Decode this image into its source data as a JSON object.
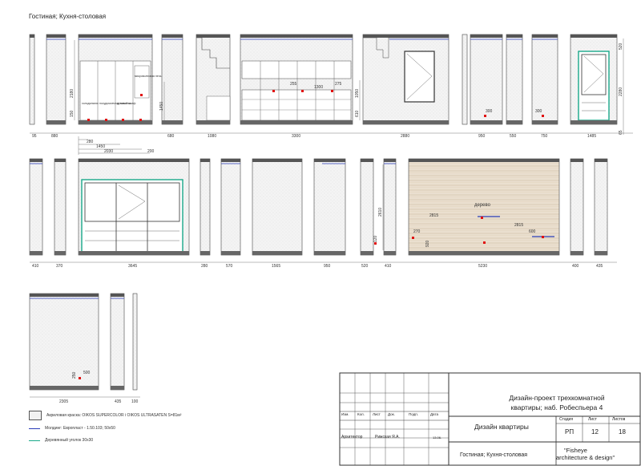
{
  "page_title": "Гостиная; Кухня-столовая",
  "row1_dims": [
    "95",
    "880",
    "680",
    "1080",
    "3300",
    "2880",
    "950",
    "550",
    "750",
    "1485"
  ],
  "row1_vdims": [
    "2180",
    "150",
    "1450",
    "1050",
    "610",
    "270",
    "100",
    "2280",
    "520",
    "65"
  ],
  "row1_kitchen_dims": [
    "1300",
    "1450",
    "2030",
    "280",
    "200",
    "255",
    "275"
  ],
  "row1_small_dims": [
    "300",
    "300",
    "150",
    "250"
  ],
  "row2_dims": [
    "410",
    "370",
    "3645",
    "280",
    "570",
    "1565",
    "950",
    "520",
    "410",
    "5230",
    "400",
    "435"
  ],
  "row2_vdims": [
    "2610",
    "120",
    "100",
    "160",
    "250",
    "920"
  ],
  "wood_label": "дерево",
  "wood_dims": [
    "2815",
    "2815",
    "270",
    "600",
    "920"
  ],
  "row3_dims": [
    "2305",
    "435",
    "100"
  ],
  "row3_small_dims": [
    "250",
    "500"
  ],
  "appliance_labels": [
    "холодильник",
    "посудомоечная машина",
    "духовой шкаф",
    "микроволновая печь"
  ],
  "legend": {
    "paint": "Акриловая краска: OIKOS SUPERCOLOR i OIKOS ULTRASATEN  S=81м²",
    "molding": "Молдинг: Европласт - 1.50.103; 50х50",
    "corner": "Деревянный уголок 30х30"
  },
  "colors": {
    "blue": "#2b3db8",
    "teal": "#1aa98a",
    "red": "#e01010",
    "wall": "#cfcfcf"
  },
  "title_block": {
    "project": "Дизайн-проект трехкомнатной квартиры; наб. Робеспьера 4",
    "project_line1": "Дизайн-проект трехкомнатной",
    "project_line2": "квартиры; наб. Робеспьера 4",
    "doc": "Дизайн квартиры",
    "sheet_name": "Гостиная; Кухня-столовая",
    "company_line1": "\"Fisheye",
    "company_line2": "architecture & design\"",
    "h_izm": "Изм.",
    "h_kol": "Кол.",
    "h_list": "Лист",
    "h_doc": "Док.",
    "h_podp": "Подп.",
    "h_date": "Дата",
    "role": "Архитектор",
    "person": "Рижская Я.А.",
    "date": "13.06.",
    "stage_h": "Стадия",
    "sheet_h": "Лист",
    "sheets_h": "Листов",
    "stage": "РП",
    "sheet": "12",
    "sheets": "18"
  }
}
